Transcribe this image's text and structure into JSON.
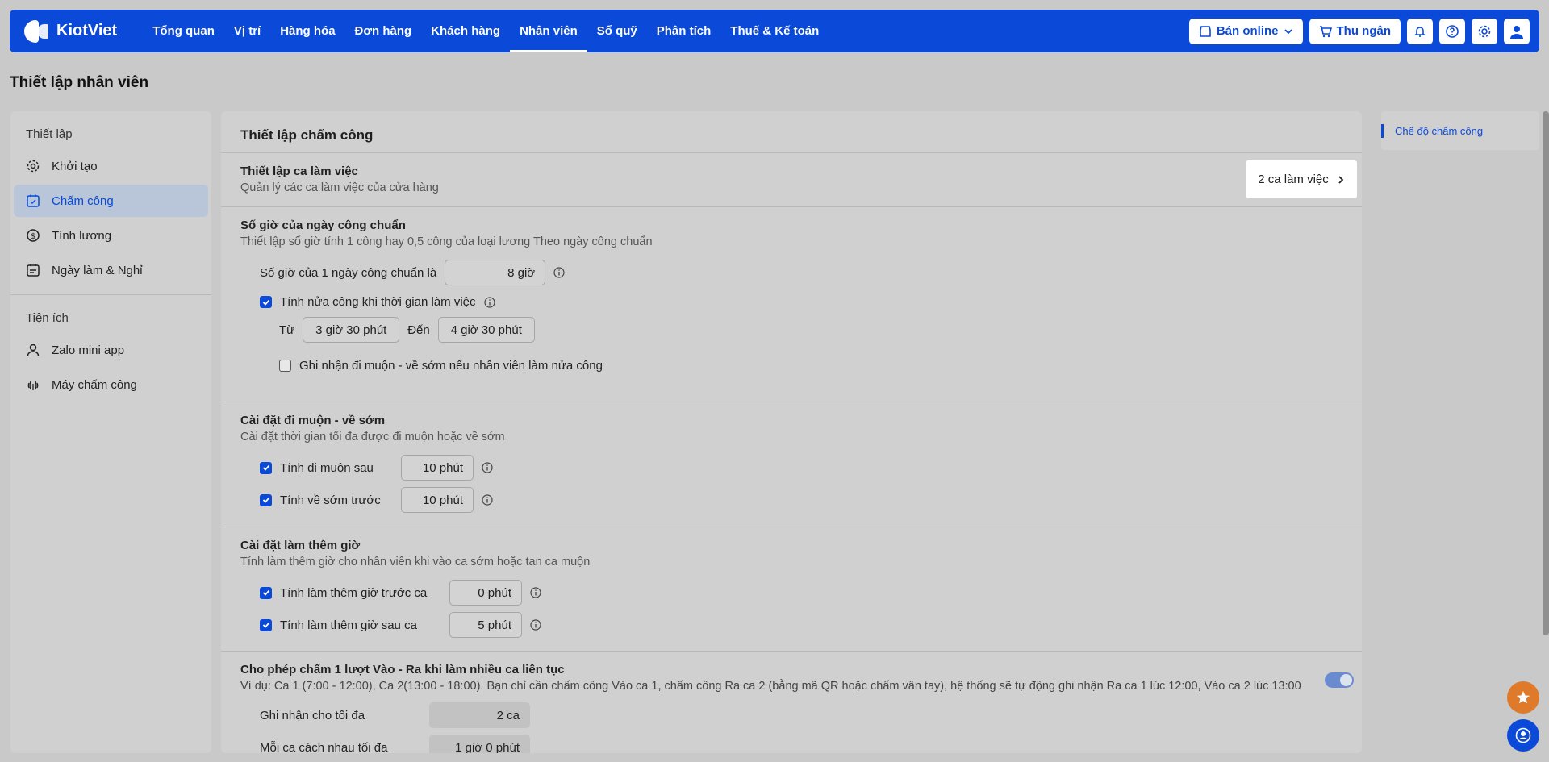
{
  "app": {
    "brand": "KiotViet"
  },
  "nav": [
    {
      "label": "Tổng quan"
    },
    {
      "label": "Vị trí"
    },
    {
      "label": "Hàng hóa"
    },
    {
      "label": "Đơn hàng"
    },
    {
      "label": "Khách hàng"
    },
    {
      "label": "Nhân viên",
      "active": true
    },
    {
      "label": "Sổ quỹ"
    },
    {
      "label": "Phân tích"
    },
    {
      "label": "Thuế & Kế toán"
    }
  ],
  "top_actions": {
    "online_label": "Bán online",
    "cashier_label": "Thu ngân",
    "icons": [
      "bell-icon",
      "help-icon",
      "gear-icon",
      "user-icon"
    ]
  },
  "page_title": "Thiết lập nhân viên",
  "sidebar": {
    "group1_title": "Thiết lập",
    "items": [
      {
        "label": "Khởi tạo",
        "icon": "gear-icon"
      },
      {
        "label": "Chấm công",
        "icon": "calendar-check-icon",
        "active": true
      },
      {
        "label": "Tính lương",
        "icon": "dollar-icon"
      },
      {
        "label": "Ngày làm & Nghỉ",
        "icon": "calendar-icon"
      }
    ],
    "group2_title": "Tiện ích",
    "items2": [
      {
        "label": "Zalo mini app",
        "icon": "person-icon"
      },
      {
        "label": "Máy chấm công",
        "icon": "fingerprint-icon"
      }
    ]
  },
  "main": {
    "title": "Thiết lập chấm công",
    "shift": {
      "title": "Thiết lập ca làm việc",
      "desc": "Quản lý các ca làm việc của cửa hàng",
      "button": "2 ca làm việc"
    },
    "standard": {
      "title": "Số giờ của ngày công chuẩn",
      "desc": "Thiết lập số giờ tính 1 công hay 0,5 công của loại lương Theo ngày công chuẩn",
      "hours_label": "Số giờ của 1 ngày công chuẩn là",
      "hours_value": "8 giờ",
      "half_label": "Tính nửa công khi thời gian làm việc",
      "half_checked": true,
      "from_label": "Từ",
      "from_value": "3 giờ 30 phút",
      "to_label": "Đến",
      "to_value": "4 giờ 30 phút",
      "late_half_label": "Ghi nhận đi muộn - về sớm nếu nhân viên làm nửa công",
      "late_half_checked": false
    },
    "late": {
      "title": "Cài đặt đi muộn - về sớm",
      "desc": "Cài đặt thời gian tối đa được đi muộn hoặc về sớm",
      "late_label": "Tính đi muộn sau",
      "late_value": "10 phút",
      "early_label": "Tính về sớm trước",
      "early_value": "10 phút"
    },
    "overtime": {
      "title": "Cài đặt làm thêm giờ",
      "desc": "Tính làm thêm giờ cho nhân viên khi vào ca sớm hoặc tan ca muộn",
      "before_label": "Tính làm thêm giờ trước ca",
      "before_value": "0 phút",
      "after_label": "Tính làm thêm giờ sau ca",
      "after_value": "5 phút"
    },
    "multi": {
      "title": "Cho phép chấm 1 lượt Vào - Ra khi làm nhiều ca liên tục",
      "desc": "Ví dụ: Ca 1 (7:00 - 12:00), Ca 2(13:00 - 18:00). Bạn chỉ cần chấm công Vào ca 1, chấm công Ra ca 2 (bằng mã QR hoặc chấm vân tay), hệ thống sẽ tự động ghi nhận Ra ca 1 lúc 12:00, Vào ca 2 lúc 13:00",
      "enabled": true,
      "max_label": "Ghi nhận cho tối đa",
      "max_value": "2 ca",
      "gap_label": "Mỗi ca cách nhau tối đa",
      "gap_value": "1 giờ 0 phút"
    }
  },
  "rail": {
    "link": "Chế độ chấm công"
  },
  "colors": {
    "brand": "#0b4ad8",
    "fab_star": "#e07a2b"
  }
}
